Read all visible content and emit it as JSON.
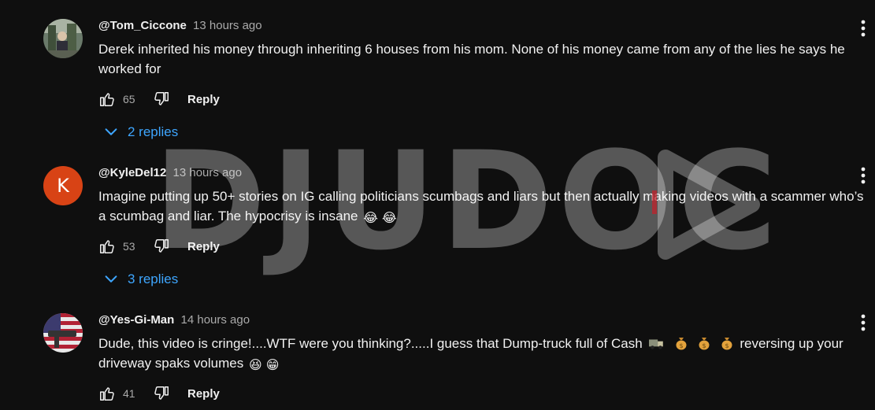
{
  "comments": [
    {
      "author": "@Tom_Ciccone",
      "time": "13 hours ago",
      "text": "Derek inherited his money through inheriting 6 houses from his mom. None of his money came from any of the lies he says he worked for",
      "likes": "65",
      "reply_label": "Reply",
      "replies_label": "2 replies",
      "avatar_icon": "photo-avatar"
    },
    {
      "author": "@KyleDel12",
      "time": "13 hours ago",
      "text": "Imagine putting up 50+ stories on IG calling politicians scumbags and liars but then actually making videos with a scammer who’s a scumbag and liar. The hypocrisy is insane",
      "text_emojis": "😂 😂",
      "likes": "53",
      "reply_label": "Reply",
      "replies_label": "3 replies",
      "avatar_letter": "K",
      "avatar_color": "#d84315"
    },
    {
      "author": "@Yes-Gi-Man",
      "time": "14 hours ago",
      "text_part1": "Dude, this video is cringe!....WTF were you thinking?.....I guess that Dump-truck full of Cash",
      "text_part2": "reversing up your driveway spaks volumes",
      "text_emojis_end": "😆 😁",
      "likes": "41",
      "reply_label": "Reply",
      "avatar_icon": "flag-avatar"
    }
  ],
  "watermark": {
    "text": "DJUDOC"
  },
  "colors": {
    "background": "#0f0f0f",
    "link_blue": "#3ea6ff",
    "muted": "#aaaaaa"
  }
}
